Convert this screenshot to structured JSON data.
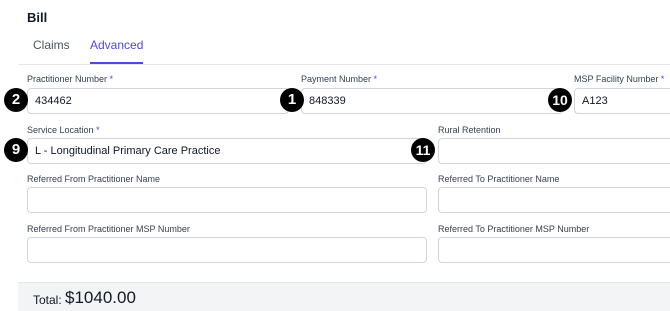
{
  "header": {
    "title": "Bill"
  },
  "tabs": [
    {
      "label": "Claims",
      "active": false
    },
    {
      "label": "Advanced",
      "active": true
    }
  ],
  "form": {
    "practitioner_number": {
      "label": "Practitioner Number",
      "required_mark": "*",
      "value": "434462"
    },
    "payment_number": {
      "label": "Payment Number",
      "required_mark": "*",
      "value": "848339"
    },
    "msp_facility_number": {
      "label": "MSP Facility Number",
      "required_mark": "*",
      "value": "A123"
    },
    "service_location": {
      "label": "Service Location",
      "required_mark": "*",
      "value": "L - Longitudinal Primary Care Practice"
    },
    "rural_retention": {
      "label": "Rural Retention",
      "value": ""
    },
    "referred_from_name": {
      "label": "Referred From Practitioner Name",
      "value": ""
    },
    "referred_to_name": {
      "label": "Referred To Practitioner Name",
      "value": ""
    },
    "referred_from_msp": {
      "label": "Referred From Practitioner MSP Number",
      "value": ""
    },
    "referred_to_msp": {
      "label": "Referred To Practitioner MSP Number",
      "value": ""
    }
  },
  "markers": {
    "m1": "1",
    "m2": "2",
    "m9": "9",
    "m10": "10",
    "m11": "11"
  },
  "footer": {
    "total_label": "Total:",
    "total_value": "$1040.00"
  },
  "colors": {
    "accent": "#4f46e5",
    "marker": "#000000"
  }
}
